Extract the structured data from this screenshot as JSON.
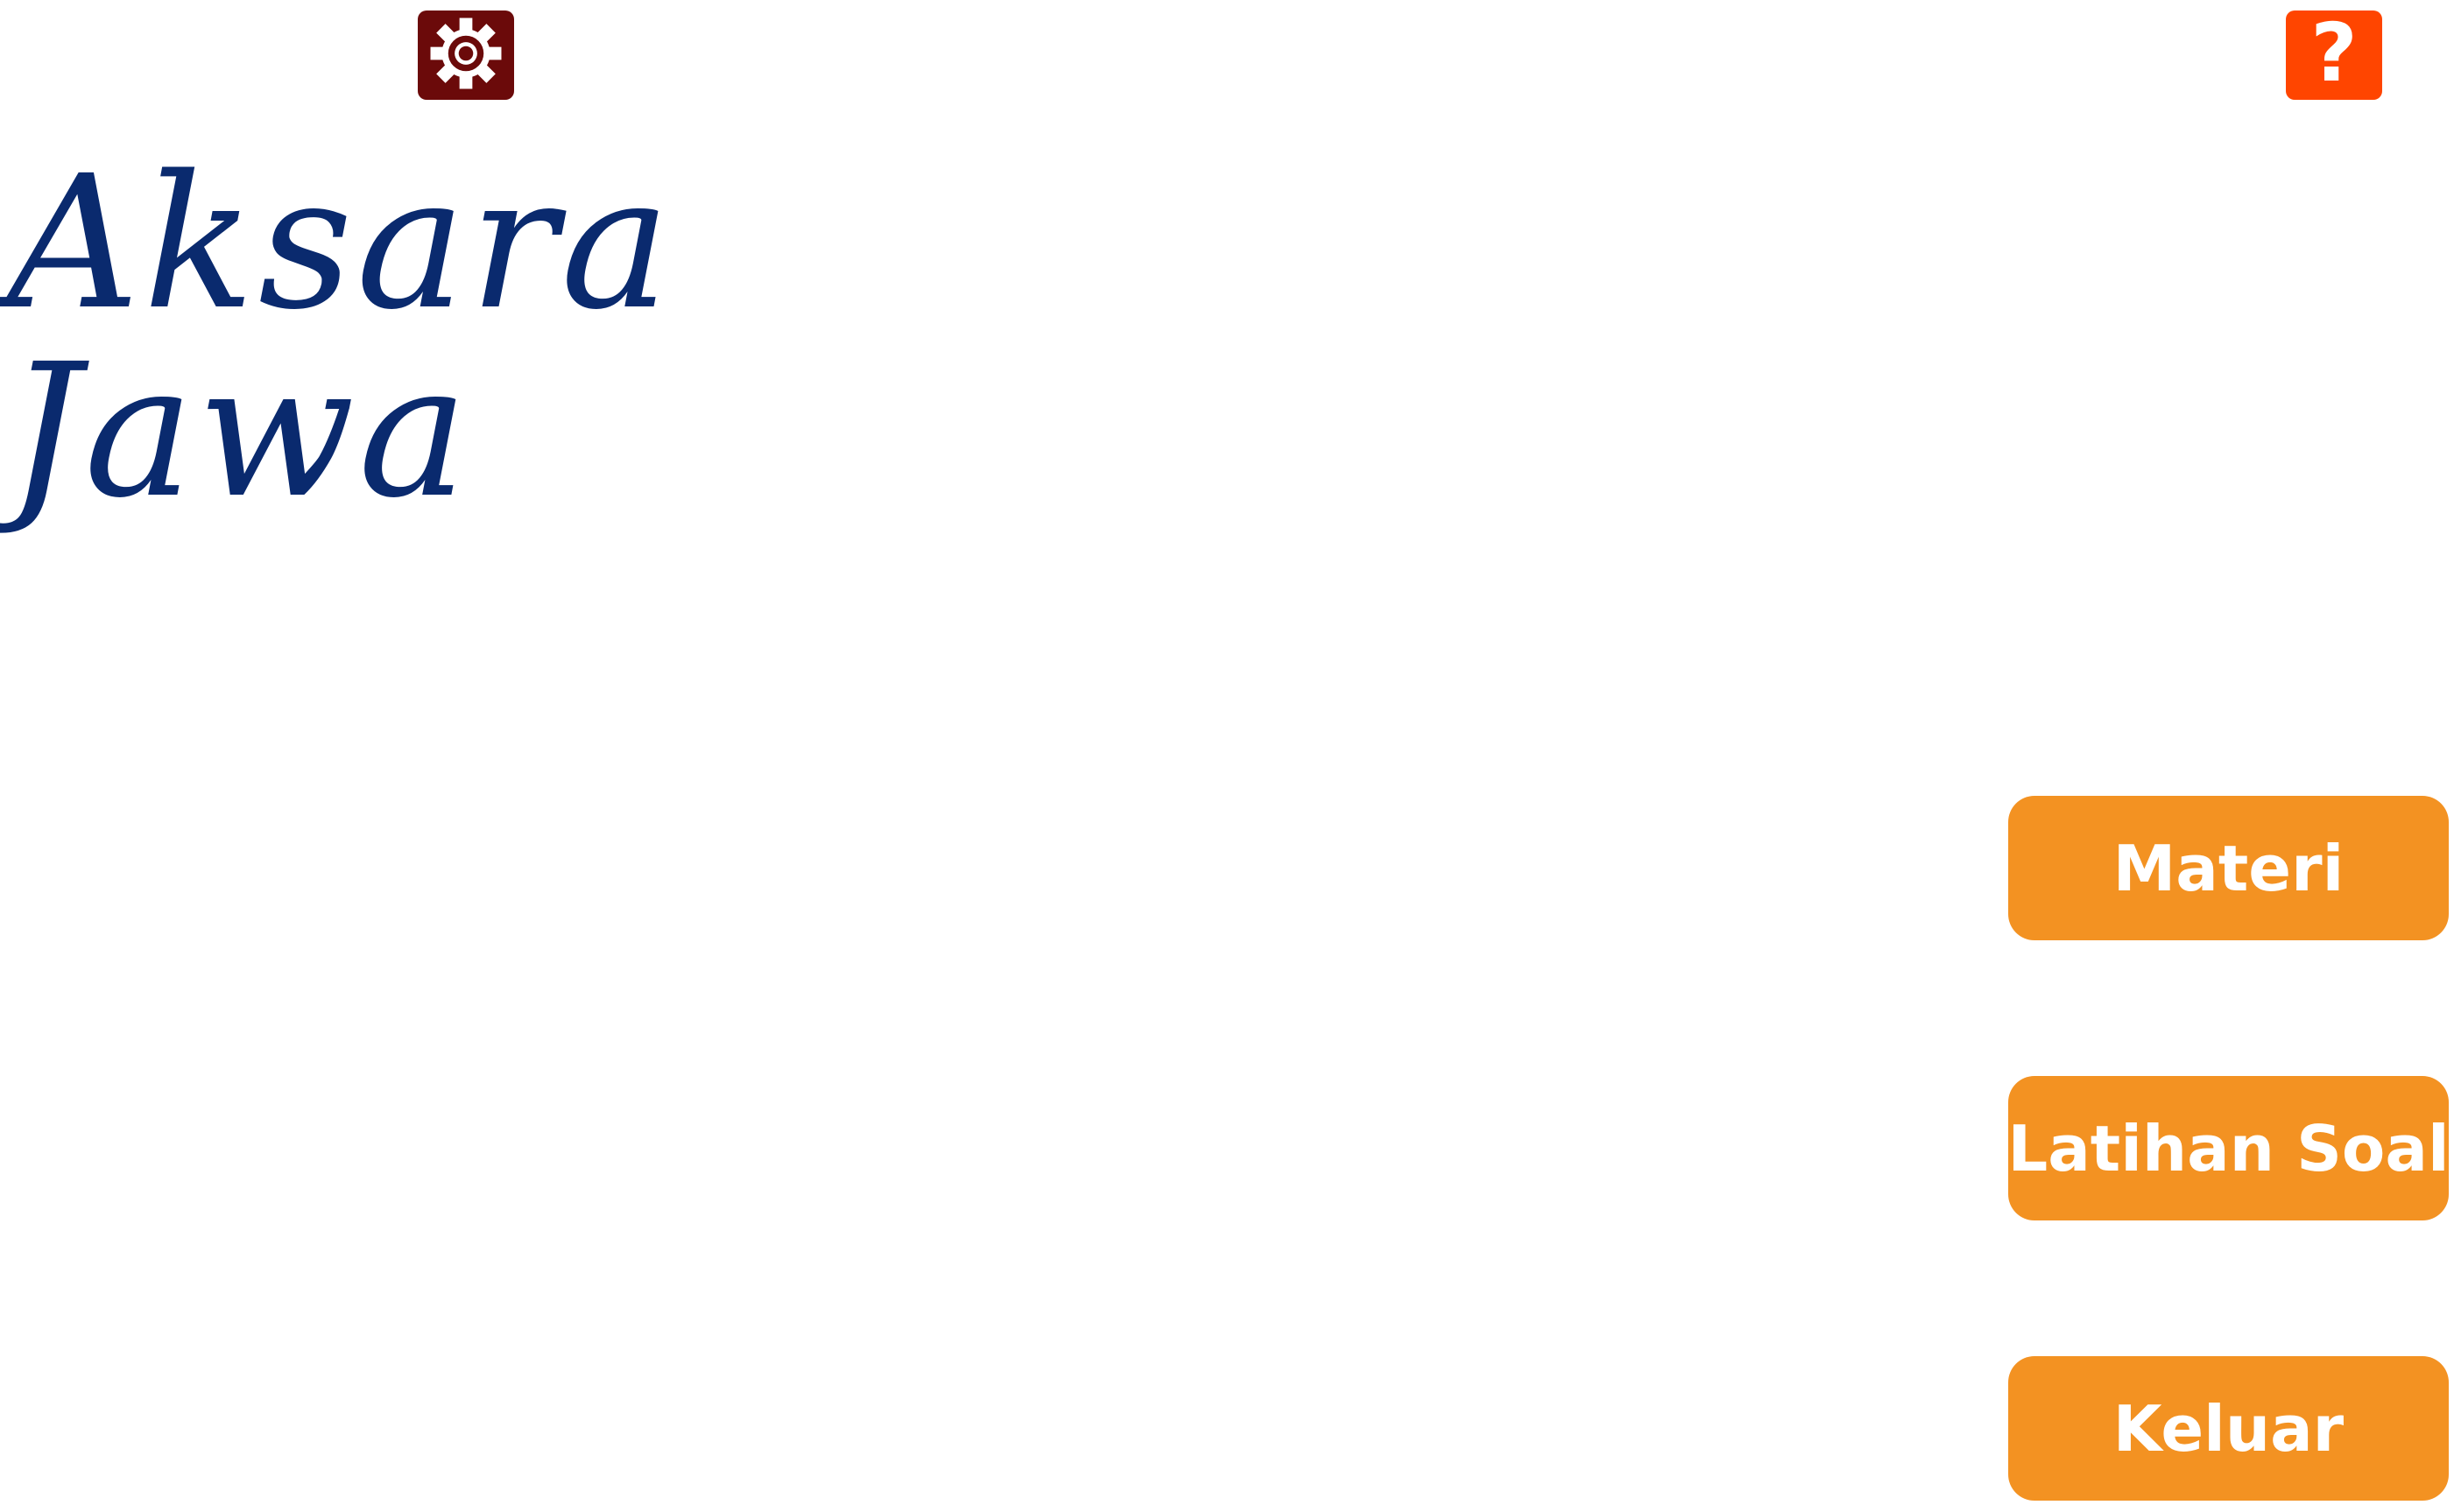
{
  "header": {
    "settings_icon": "gear-icon",
    "help_icon": "question-icon",
    "help_glyph": "?"
  },
  "title": {
    "line1": "Aksara",
    "line2": "Jawa",
    "color": "#0a2a6e"
  },
  "menu": {
    "materi_label": "Materi",
    "latihan_label": "Latihan Soal",
    "keluar_label": "Keluar",
    "button_color": "#f39222"
  },
  "colors": {
    "settings_bg": "#6b0a0a",
    "help_bg": "#ff4500"
  }
}
